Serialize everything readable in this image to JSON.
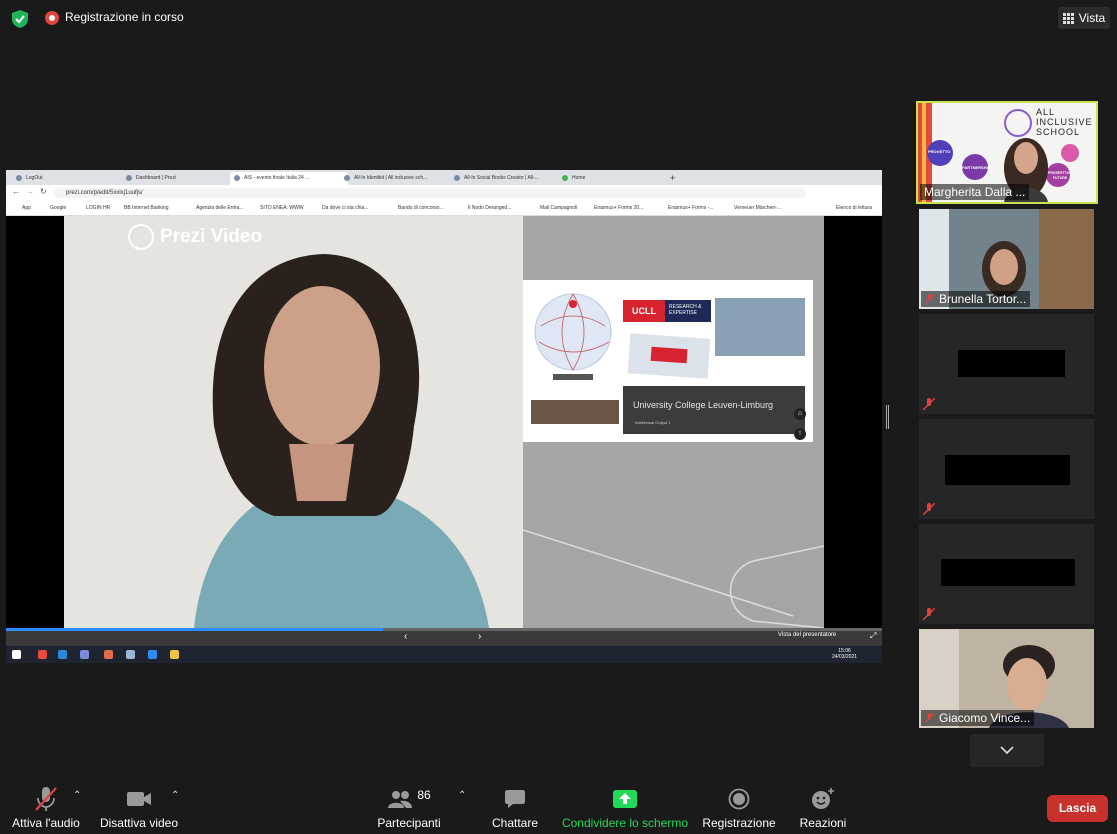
{
  "top_bar": {
    "recording_status": "Registrazione in corso",
    "view_label": "Vista"
  },
  "shared_screen": {
    "browser_tabs": [
      "LogOut",
      "Dashboard | Prezi",
      "AIS - evento finale Italia 24 ...",
      "All-In Identikit | All inclusive sch...",
      "All-In Social Books Creator | All-...",
      "Home"
    ],
    "url": "prezi.com/p/edit/5xxlxj1uufjs/",
    "bookmarks": [
      "App",
      "Google",
      "LOGIN HR",
      "BB Internet Banking",
      "Agenzia delle Entra...",
      "SITO ENEA: WWW",
      "Da dove ci sta chia...",
      "Bando di concorso...",
      "Il Nodo Deranged...",
      "Mail Campagnoli",
      "Erasmus+ Forms 20...",
      "Erasmus+ Forms -...",
      "Verneuer Märchen-...",
      "Elenco di lettura"
    ],
    "prezi_logo_text": "Prezi Video",
    "slide": {
      "ucll_logo": "UCLL",
      "ucll_tagline": "RESEARCH & EXPERTISE",
      "title": "University College Leuven-Limburg",
      "subtitle": "Intellectual Output 1"
    },
    "presenter_view_label": "Vista del presentatore",
    "taskbar_time": "15:06",
    "taskbar_date": "24/03/2021",
    "progress": 0.43
  },
  "participants_panel": {
    "tiles": [
      {
        "name": "Margherita Dalla ...",
        "logo_lines": [
          "ALL",
          "INCLUSIVE",
          "SCHOOL"
        ],
        "bubbles": [
          "PROGETTO",
          "PARTNERSHIP",
          "PROSPETTIVE FUTURE"
        ]
      },
      {
        "name": "Brunella Tortor..."
      },
      {
        "name": ""
      },
      {
        "name": ""
      },
      {
        "name": ""
      },
      {
        "name": "Giacomo Vince..."
      }
    ]
  },
  "toolbar": {
    "audio_label": "Attiva l'audio",
    "video_label": "Disattiva video",
    "participants_label": "Partecipanti",
    "participants_count": "86",
    "chat_label": "Chattare",
    "share_label": "Condividere lo schermo",
    "record_label": "Registrazione",
    "reactions_label": "Reazioni",
    "leave_label": "Lascia"
  },
  "colors": {
    "background": "#1a1a1a",
    "accent_green": "#23d959",
    "leave_red": "#c9312c",
    "active_speaker_border": "#c7e34e"
  }
}
